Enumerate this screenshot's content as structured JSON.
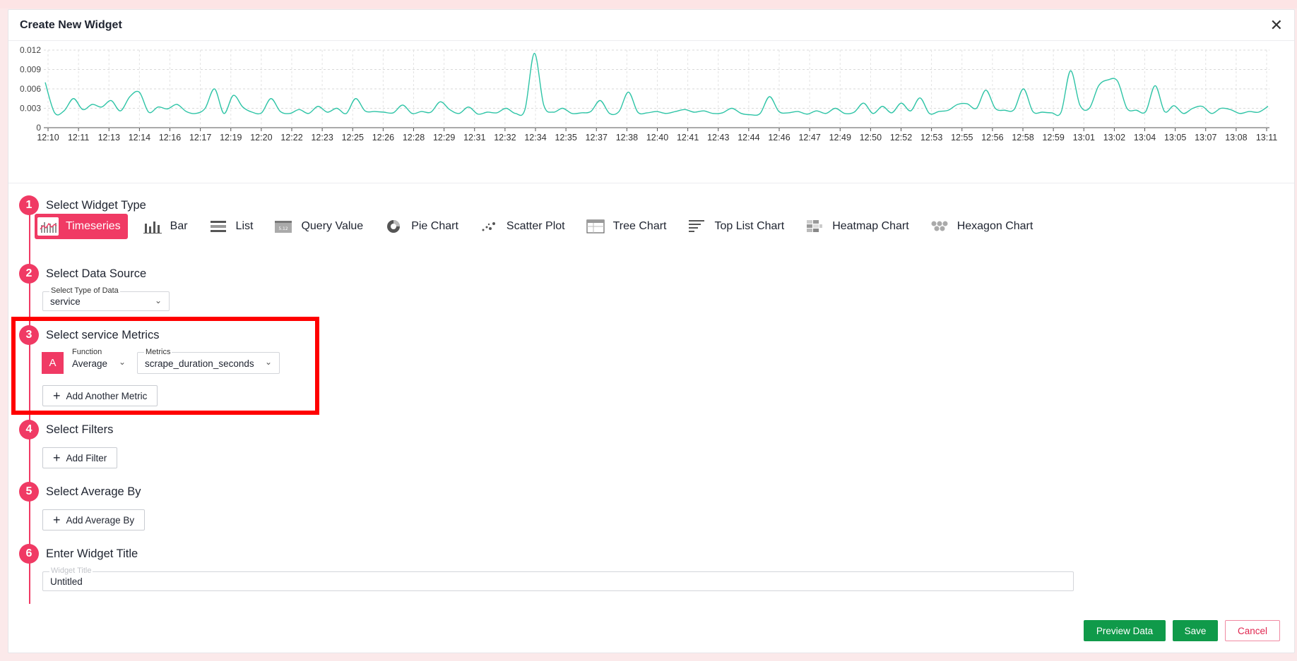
{
  "modal": {
    "title": "Create New Widget"
  },
  "chart_data": {
    "type": "line",
    "title": "",
    "xlabel": "",
    "ylabel": "",
    "ylim": [
      0,
      0.012
    ],
    "yticks": [
      "0",
      "0.003",
      "0.006",
      "0.009",
      "0.012"
    ],
    "grid": true,
    "x": [
      "12:10",
      "12:11",
      "12:13",
      "12:14",
      "12:16",
      "12:17",
      "12:19",
      "12:20",
      "12:22",
      "12:23",
      "12:25",
      "12:26",
      "12:28",
      "12:29",
      "12:31",
      "12:32",
      "12:34",
      "12:35",
      "12:37",
      "12:38",
      "12:40",
      "12:41",
      "12:43",
      "12:44",
      "12:46",
      "12:47",
      "12:49",
      "12:50",
      "12:52",
      "12:53",
      "12:55",
      "12:56",
      "12:58",
      "12:59",
      "13:01",
      "13:02",
      "13:04",
      "13:05",
      "13:07",
      "13:08",
      "13:11"
    ],
    "series": [
      {
        "color": "#2ec4a6",
        "values": [
          0.007,
          0.0023,
          0.0026,
          0.0045,
          0.0028,
          0.0036,
          0.0032,
          0.0042,
          0.0026,
          0.0048,
          0.0055,
          0.0024,
          0.0032,
          0.0029,
          0.0036,
          0.0025,
          0.0022,
          0.003,
          0.006,
          0.0022,
          0.005,
          0.0032,
          0.0024,
          0.0023,
          0.0045,
          0.0025,
          0.0022,
          0.0028,
          0.0022,
          0.0033,
          0.0024,
          0.003,
          0.0022,
          0.0045,
          0.0026,
          0.0025,
          0.0024,
          0.0023,
          0.0035,
          0.0022,
          0.0025,
          0.0024,
          0.004,
          0.0028,
          0.0022,
          0.0032,
          0.0021,
          0.0024,
          0.0023,
          0.003,
          0.0022,
          0.0028,
          0.0115,
          0.0035,
          0.0024,
          0.003,
          0.0022,
          0.0023,
          0.0025,
          0.0042,
          0.0022,
          0.0025,
          0.0055,
          0.0024,
          0.0023,
          0.0025,
          0.0022,
          0.0025,
          0.0028,
          0.0024,
          0.0026,
          0.0022,
          0.0023,
          0.003,
          0.0022,
          0.002,
          0.0022,
          0.0048,
          0.0025,
          0.0023,
          0.0025,
          0.0021,
          0.0026,
          0.0022,
          0.003,
          0.0022,
          0.0024,
          0.0038,
          0.0022,
          0.0033,
          0.0023,
          0.0038,
          0.0026,
          0.0046,
          0.0022,
          0.0025,
          0.0027,
          0.0036,
          0.0037,
          0.003,
          0.0058,
          0.003,
          0.0027,
          0.0028,
          0.006,
          0.0025,
          0.0024,
          0.0023,
          0.0024,
          0.0088,
          0.0035,
          0.003,
          0.0065,
          0.0074,
          0.0072,
          0.003,
          0.0027,
          0.0025,
          0.0065,
          0.0025,
          0.0034,
          0.0022,
          0.003,
          0.0033,
          0.0022,
          0.003,
          0.0028,
          0.0022,
          0.0025,
          0.0024,
          0.0033
        ]
      }
    ]
  },
  "steps": [
    {
      "num": "1",
      "label": "Select Widget Type"
    },
    {
      "num": "2",
      "label": "Select Data Source"
    },
    {
      "num": "3",
      "label": "Select service Metrics"
    },
    {
      "num": "4",
      "label": "Select Filters"
    },
    {
      "num": "5",
      "label": "Select Average By"
    },
    {
      "num": "6",
      "label": "Enter Widget Title"
    }
  ],
  "widget_types": [
    {
      "label": "Timeseries",
      "icon": "timeseries-icon",
      "active": true
    },
    {
      "label": "Bar",
      "icon": "bar-chart-icon"
    },
    {
      "label": "List",
      "icon": "list-icon"
    },
    {
      "label": "Query Value",
      "icon": "query-value-icon"
    },
    {
      "label": "Pie Chart",
      "icon": "pie-chart-icon"
    },
    {
      "label": "Scatter Plot",
      "icon": "scatter-plot-icon"
    },
    {
      "label": "Tree Chart",
      "icon": "tree-chart-icon"
    },
    {
      "label": "Top List Chart",
      "icon": "top-list-icon"
    },
    {
      "label": "Heatmap Chart",
      "icon": "heatmap-icon"
    },
    {
      "label": "Hexagon Chart",
      "icon": "hexagon-icon"
    }
  ],
  "query_value_icon_text": "5.12",
  "data_source": {
    "label": "Select Type of Data",
    "value": "service"
  },
  "metrics": {
    "badge": "A",
    "function_label": "Function",
    "function_value": "Average",
    "metrics_label": "Metrics",
    "metrics_value": "scrape_duration_seconds",
    "add_metric": "Add Another Metric"
  },
  "filters": {
    "add_filter": "Add Filter"
  },
  "average_by": {
    "add_average_by": "Add Average By"
  },
  "widget_title": {
    "label": "Widget Title",
    "value": "Untitled"
  },
  "footer": {
    "preview": "Preview Data",
    "save": "Save",
    "cancel": "Cancel"
  },
  "colors": {
    "accent": "#f03a64",
    "green": "#109a4a",
    "line": "#2ec4a6",
    "highlight": "#ff0000"
  }
}
